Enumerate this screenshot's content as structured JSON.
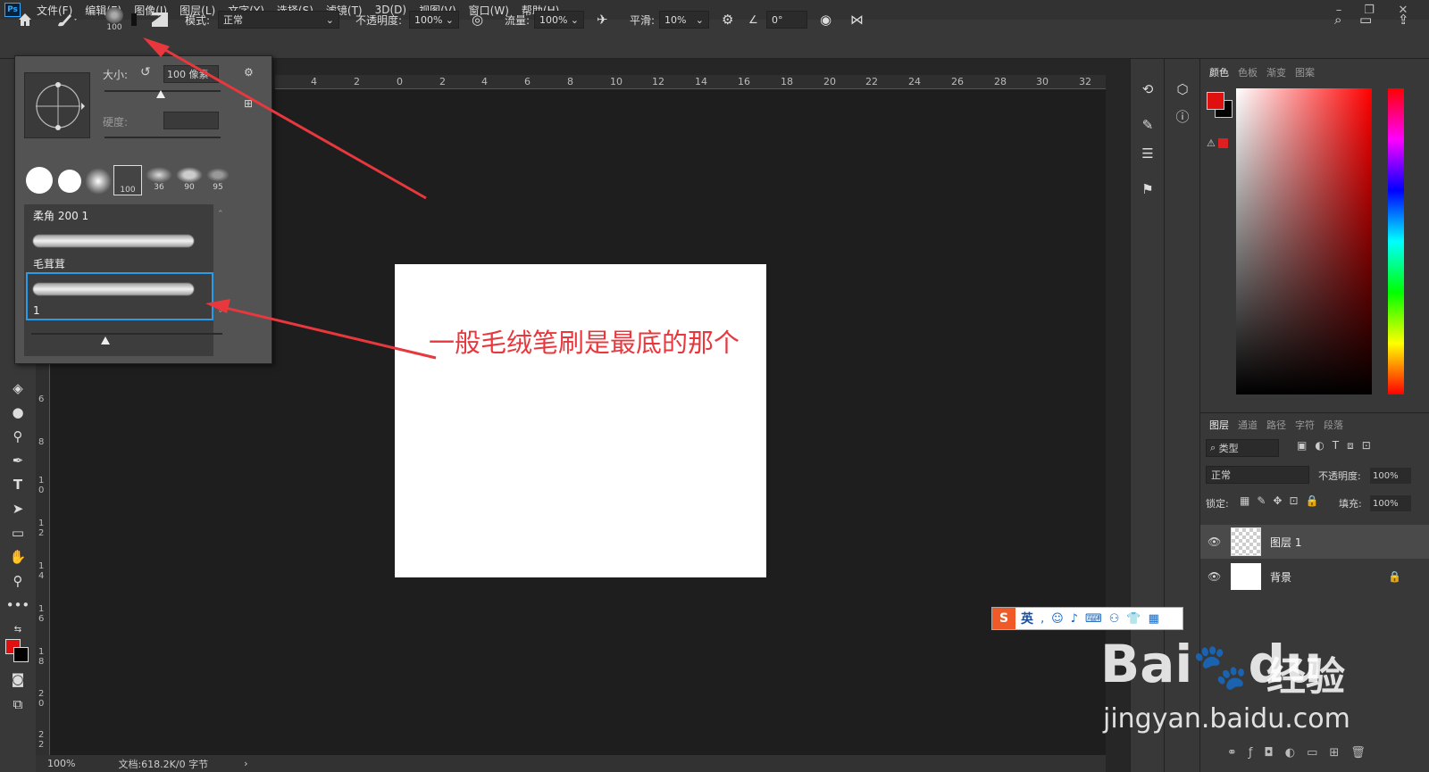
{
  "app": {
    "logo": "Ps"
  },
  "menu": [
    "文件(F)",
    "编辑(E)",
    "图像(I)",
    "图层(L)",
    "文字(Y)",
    "选择(S)",
    "滤镜(T)",
    "3D(D)",
    "视图(V)",
    "窗口(W)",
    "帮助(H)"
  ],
  "window_controls": [
    "–",
    "❐",
    "✕"
  ],
  "options": {
    "brush_size": "100",
    "mode_label": "模式:",
    "mode_value": "正常",
    "opacity_label": "不透明度:",
    "opacity_value": "100%",
    "flow_label": "流量:",
    "flow_value": "100%",
    "smooth_label": "平滑:",
    "smooth_value": "10%",
    "angle_value": "0°"
  },
  "brush_popup": {
    "size_label": "大小:",
    "size_value": "100 像素",
    "hardness_label": "硬度:",
    "preset_sizes": [
      "100",
      "36",
      "90",
      "95"
    ],
    "group_name": "柔角 200 1",
    "preset1_name": "毛茸茸",
    "preset2_name": "1"
  },
  "ruler_top": [
    "4",
    "2",
    "0",
    "2",
    "4",
    "6",
    "8",
    "10",
    "12",
    "14",
    "16",
    "18",
    "20",
    "22",
    "24",
    "26",
    "28",
    "30",
    "32"
  ],
  "ruler_left": [
    "6",
    "8",
    "1 0",
    "1 2",
    "1 4",
    "1 6",
    "1 8",
    "2 0",
    "2 2"
  ],
  "annotation": "一般毛绒笔刷是最底的那个",
  "status": {
    "zoom": "100%",
    "doc": "文档:618.2K/0 字节"
  },
  "color_panel": {
    "tabs": [
      "颜色",
      "色板",
      "渐变",
      "图案"
    ],
    "fg": "#e01010",
    "bg": "#000000"
  },
  "layers_panel": {
    "tabs": [
      "图层",
      "通道",
      "路径",
      "字符",
      "段落"
    ],
    "filter": "类型",
    "blend": "正常",
    "opacity_label": "不透明度:",
    "opacity_value": "100%",
    "lock_label": "锁定:",
    "fill_label": "填充:",
    "fill_value": "100%",
    "layers": [
      {
        "name": "图层 1"
      },
      {
        "name": "背景"
      }
    ]
  },
  "ime": {
    "label": "英"
  },
  "watermark": {
    "brand": "Bai",
    "brand2": "du",
    "cn": "经验",
    "url": "jingyan.baidu.com"
  }
}
